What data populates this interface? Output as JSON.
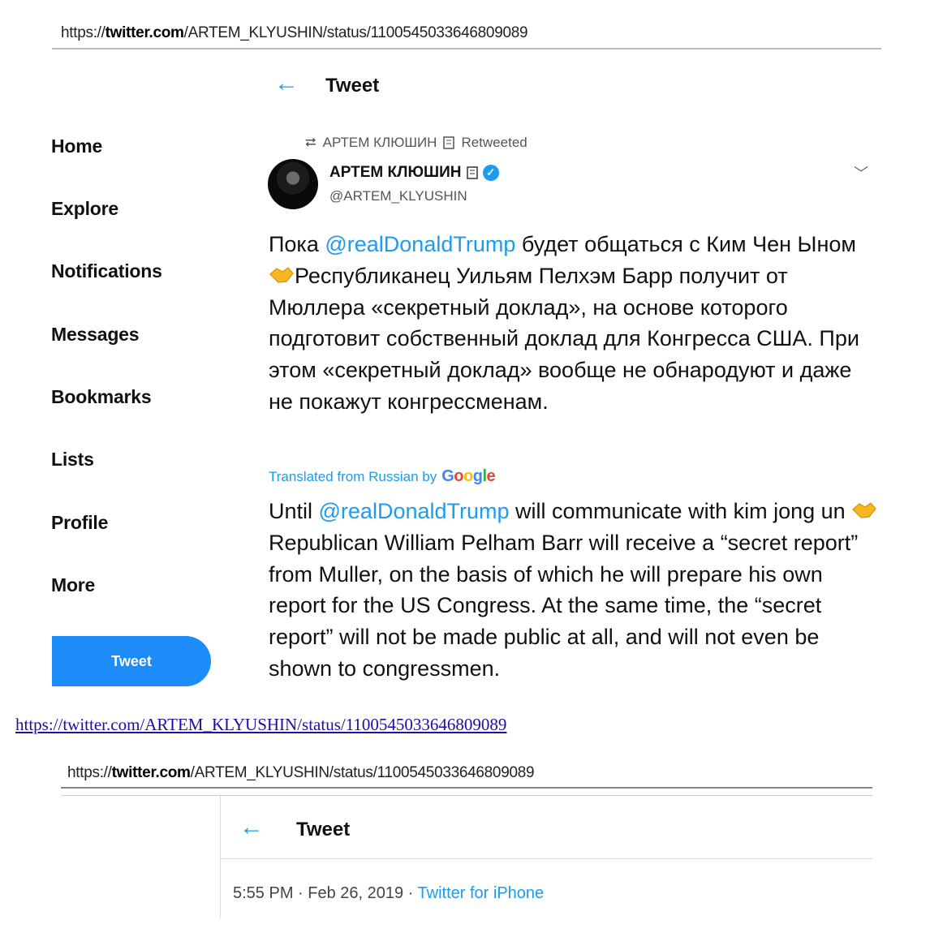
{
  "top_screenshot": {
    "url": {
      "prefix": "https://",
      "domain": "twitter.com",
      "path": "/ARTEM_KLYUSHIN/status/1100545033646809089"
    },
    "header": {
      "back_icon": "arrow-left-icon",
      "title": "Tweet"
    },
    "sidebar": {
      "items": [
        {
          "label": "Home"
        },
        {
          "label": "Explore"
        },
        {
          "label": "Notifications"
        },
        {
          "label": "Messages"
        },
        {
          "label": "Bookmarks"
        },
        {
          "label": "Lists"
        },
        {
          "label": "Profile"
        },
        {
          "label": "More"
        }
      ],
      "tweet_button": "Tweet"
    },
    "tweet": {
      "retweet_icon": "retweet-icon",
      "retweeted_by": "АРТЕМ КЛЮШИН",
      "retweeted_suffix": "Retweeted",
      "author_name": "АРТЕМ КЛЮШИН",
      "verified_icon": "verified-badge-icon",
      "handle": "@ARTEM_KLYUSHIN",
      "ru": {
        "part1": "Пока ",
        "mention": "@realDonaldTrump",
        "part2": " будет общаться с Ким Чен Ыном ",
        "part3": "Республиканец Уильям Пелхэм Барр получит от Мюллера «секретный доклад», на основе которого подготовит собственный доклад для Конгресса США. При этом «секретный доклад» вообще не обнародуют и даже не покажут конгрессменам."
      },
      "translated_label": "Translated from Russian by",
      "translated_brand": "Google",
      "en": {
        "part1": "Until ",
        "mention": "@realDonaldTrump",
        "part2": " will communicate with kim jong un ",
        "part3": " Republican William Pelham Barr will receive a “secret report” from Muller, on the basis of which he will prepare his own report for the US Congress. At the same time, the “secret report” will not be made public at all, and will not even be shown to congressmen."
      }
    }
  },
  "source_link": "https://twitter.com/ARTEM_KLYUSHIN/status/1100545033646809089",
  "bottom_screenshot": {
    "url": {
      "prefix": "https://",
      "domain": "twitter.com",
      "path": "/ARTEM_KLYUSHIN/status/1100545033646809089"
    },
    "header": {
      "title": "Tweet"
    },
    "timestamp": "5:55 PM · Feb 26, 2019 · ",
    "client": "Twitter for iPhone"
  },
  "colors": {
    "accent": "#1d9bf0",
    "button": "#1d8cf8"
  }
}
